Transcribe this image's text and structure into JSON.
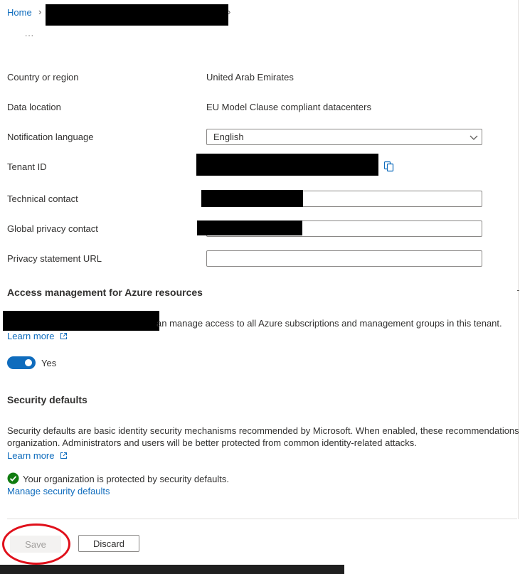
{
  "breadcrumb": {
    "home": "Home",
    "more": "..."
  },
  "properties": {
    "country_label": "Country or region",
    "country_value": "United Arab Emirates",
    "data_location_label": "Data location",
    "data_location_value": "EU Model Clause compliant datacenters",
    "notification_language_label": "Notification language",
    "notification_language_value": "English",
    "tenant_id_label": "Tenant ID",
    "technical_contact_label": "Technical contact",
    "global_privacy_contact_label": "Global privacy contact",
    "privacy_statement_label": "Privacy statement URL"
  },
  "access_management": {
    "heading": "Access management for Azure resources",
    "description_tail": "an manage access to all Azure subscriptions and management groups in this tenant.",
    "learn_more": "Learn more",
    "toggle_label": "Yes",
    "toggle_on": true
  },
  "security_defaults": {
    "heading": "Security defaults",
    "description_line1": "Security defaults are basic identity security mechanisms recommended by Microsoft. When enabled, these recommendations",
    "description_line2": "organization. Administrators and users will be better protected from common identity-related attacks.",
    "learn_more": "Learn more",
    "status": "Your organization is protected by security defaults.",
    "manage_link": "Manage security defaults"
  },
  "actions": {
    "save": "Save",
    "discard": "Discard"
  },
  "colors": {
    "accent": "#0f6cbd",
    "success": "#107c10",
    "annotation": "#e0101b"
  }
}
